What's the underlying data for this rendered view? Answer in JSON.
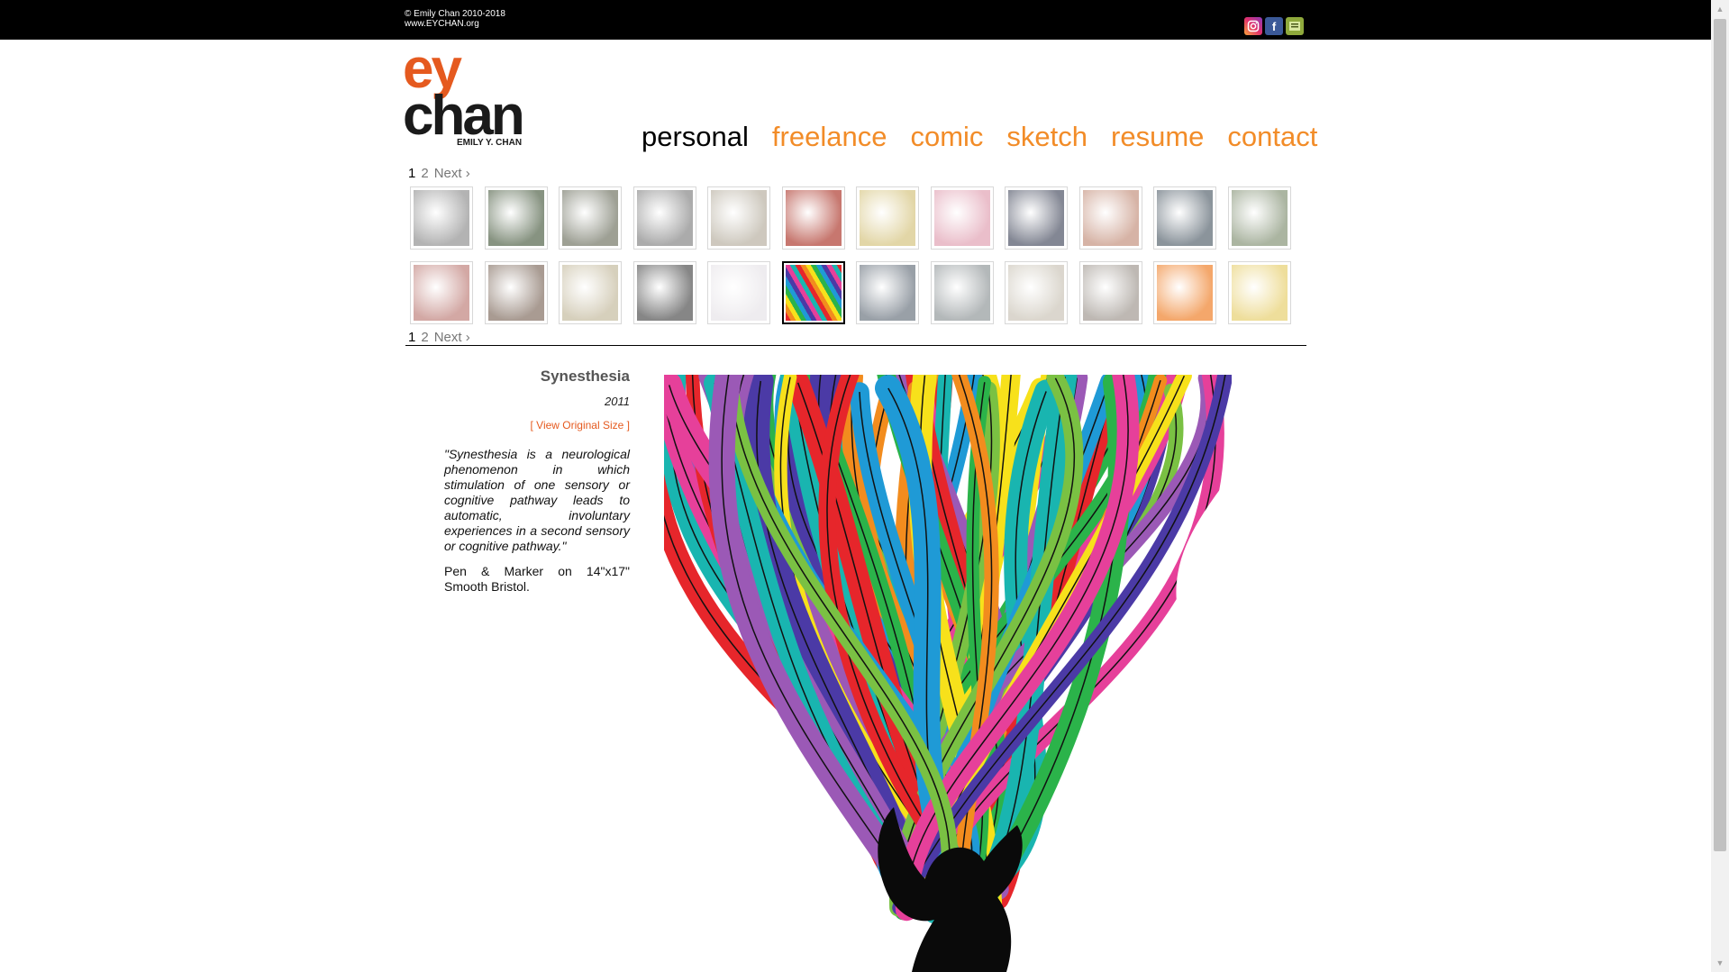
{
  "header": {
    "copyright_line1": "© Emily Chan 2010-2018",
    "copyright_line2": "www.EYCHAN.org",
    "social": [
      {
        "icon": "instagram-icon",
        "glyph": "◎",
        "color": "#e1306c"
      },
      {
        "icon": "facebook-icon",
        "glyph": "f",
        "color": "#3b5998"
      },
      {
        "icon": "other-social-icon",
        "glyph": "▤",
        "color": "#8fa93c"
      }
    ]
  },
  "logo": {
    "line1": "ey",
    "line2": "chan",
    "subtitle": "EMILY Y. CHAN",
    "accent": "#e55a1f"
  },
  "nav": {
    "items": [
      "personal",
      "freelance",
      "comic",
      "sketch",
      "resume",
      "contact"
    ],
    "active": "personal",
    "accent": "#f28c28"
  },
  "pagination": {
    "pages": [
      "1",
      "2"
    ],
    "current": "1",
    "next": "Next ›"
  },
  "gallery": {
    "row1": [
      "#9a9a9a",
      "#5f6f57",
      "#7d8071",
      "#8f8f8f",
      "#bdb6a8",
      "#b44a3f",
      "#d9c98a",
      "#e3a8b8",
      "#5a5f70",
      "#c99a88",
      "#64707a",
      "#8f9c82"
    ],
    "row2": [
      "#c48b86",
      "#8c7a6e",
      "#c9c0a6",
      "#5d5d5d",
      "#e9e6ea",
      "synesthesia",
      "#77808a",
      "#9aa0a2",
      "#cfc9bd",
      "#a8a19a",
      "#f08a3a",
      "#e9d37a"
    ],
    "selected_index_row2": 5
  },
  "artwork": {
    "title": "Synesthesia",
    "year": "2011",
    "view_original": "[ View Original Size ]",
    "quote": "\"Synesthesia is a neurological phenomenon in which stimulation of one sensory or cognitive pathway leads to automatic, involuntary experiences in a second sensory or cognitive pathway.\"",
    "medium": "Pen & Marker on 14\"x17\" Smooth Bristol."
  }
}
